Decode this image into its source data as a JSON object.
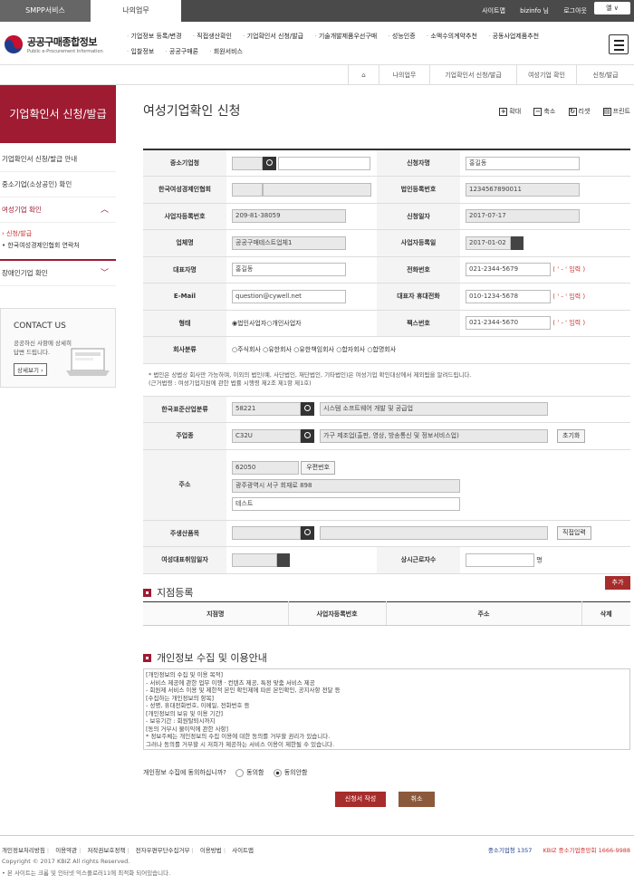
{
  "top": {
    "tab1": "SMPP서비스",
    "tab2": "나의업무",
    "links": [
      "사이트맵",
      "bizinfo 님",
      "로그아웃"
    ],
    "lang": "옐 ∨"
  },
  "header": {
    "logo_title": "공공구매종합정보",
    "logo_sub": "Public e-Procurement Information",
    "gnb_row1": [
      "기업정보 등록/변경",
      "직접생산확인",
      "기업확인서 신청/발급",
      "기술개발제품우선구매",
      "성능인증",
      "소액수의계약추천",
      "공동사업제품추천"
    ],
    "gnb_row2": [
      "입찰정보",
      "공공구매론",
      "회원서비스"
    ]
  },
  "breadcrumb": [
    "나의업무",
    "기업확인서 신청/발급",
    "여성기업 확인",
    "신청/발급"
  ],
  "sidebar": {
    "title": "기업확인서 신청/발급",
    "items": [
      "기업확인서 신청/발급 안내",
      "중소기업(소상공인) 확인",
      "여성기업 확인"
    ],
    "sub": [
      "› 신청/발급",
      "• 한국여성경제인협회 연락처"
    ],
    "item4": "장애인기업 확인",
    "contact": {
      "title": "CONTACT US",
      "text1": "공공하신 사항에 상세히",
      "text2": "답변 드립니다.",
      "btn": "상세보기 ›"
    }
  },
  "page": {
    "title": "여성기업확인 신청",
    "tools": [
      "확대",
      "축소",
      "리셋",
      "프린트"
    ]
  },
  "form": {
    "sme": "중소기업청",
    "applicant_l": "신청자명",
    "applicant": "홍길동",
    "assoc": "한국여성경제인협회",
    "corpno_l": "법인등록번호",
    "corpno": "1234567890011",
    "bizno_l": "사업자등록번호",
    "bizno": "209-81-38059",
    "appdate_l": "신청일자",
    "appdate": "2017-07-17",
    "company_l": "업체명",
    "company": "공공구매테스트업체1",
    "bizdate_l": "사업자등록일",
    "bizdate": "2017-01-02",
    "ceo_l": "대표자명",
    "ceo": "홍길동",
    "tel_l": "전화번호",
    "tel": "021-2344-5679",
    "email_l": "E-Mail",
    "email": "question@cywell.net",
    "mobile_l": "대표자 휴대전화",
    "mobile": "010-1234-5678",
    "form_l": "형태",
    "form_opts": [
      "법인사업자",
      "개인사업자"
    ],
    "fax_l": "팩스번호",
    "fax": "021-2344-5670",
    "type_l": "회사분류",
    "type_opts": [
      "주식회사",
      "유한회사",
      "유한책임회사",
      "합자회사",
      "합명회사"
    ],
    "input_hint": "( ' - ' 입력 )",
    "note1": "* 법인은 상법상 회사만 가능하며, 이외의 법인(예, 사단법인, 재단법인, 기타법인)은 여성기업 확인대상에서 제외됨을 알려드립니다.",
    "note2": "(근거법령 : 여성기업지원에 관한 법률 시행령 제2조 제1항 제1호)",
    "ksic_l": "한국표준산업분류",
    "ksic": "58221",
    "ksic_name": "시스템 소프트웨어 개발 및 공급업",
    "main_l": "주업종",
    "main_code": "C32U",
    "main_name": "가구 제조업(출판, 영상, 방송통신 및 정보서비스업)",
    "reset": "초기화",
    "addr_l": "주소",
    "zip": "62050",
    "zip_btn": "우편번호",
    "addr1": "광주광역시 서구 회재로 898",
    "addr2": "테스트",
    "prod_l": "주생산품목",
    "direct_btn": "직접입력",
    "ceo_date_l": "여성대표취임일자",
    "staff_l": "상시근로자수",
    "staff_unit": "명"
  },
  "branch": {
    "title": "지점등록",
    "add": "추가",
    "cols": [
      "지점명",
      "사업자등록번호",
      "주소",
      "삭제"
    ]
  },
  "privacy": {
    "title": "개인정보 수집 및 이용안내",
    "lines": [
      "[개인정보의 수집 및 이용 목적]",
      "- 서비스 제공에 관한 업무 이행 · 컨텐츠 제공, 특정 맞춤 서비스 제공",
      "- 회원제 서비스 이용 및 제한적 본인 확인제에 따른 본인확인, 공지사항 전달 등",
      "[수집하는 개인정보의 항목]",
      "- 성명, 휴대전화번호, 이메일, 전화번호 등",
      "[개인정보의 보유 및 이용 기간]",
      "- 보유기간 : 회원탈퇴시까지",
      "[동의 거부시 불이익에 관한 사항]",
      "* 정보주체는 개인정보의 수집 이용에 대한 동의를 거부할 권리가 있습니다.",
      "  그러나 동의를 거부할 시 저희가 제공하는 서비스 이용이 제한될 수 있습니다."
    ],
    "question": "개인정보 수집에 동의하십니까?",
    "agree": "동의함",
    "disagree": "동의안함"
  },
  "buttons": {
    "submit": "신청서 작성",
    "cancel": "취소"
  },
  "footer": {
    "links": [
      "개인정보처리방침",
      "이용약관",
      "저작권보호정책",
      "전자우편무단수집거부",
      "이용방법",
      "사이트맵"
    ],
    "copy": "Copyright © 2017 KBIZ All rights Reserved.",
    "notice": "• 본 사이트는 크롬 및 인터넷 익스플로러11에 최적화 되어있습니다.",
    "agency": "중소기업청 1357",
    "kbiz": "KBIZ 중소기업중앙회 1666-9988"
  }
}
